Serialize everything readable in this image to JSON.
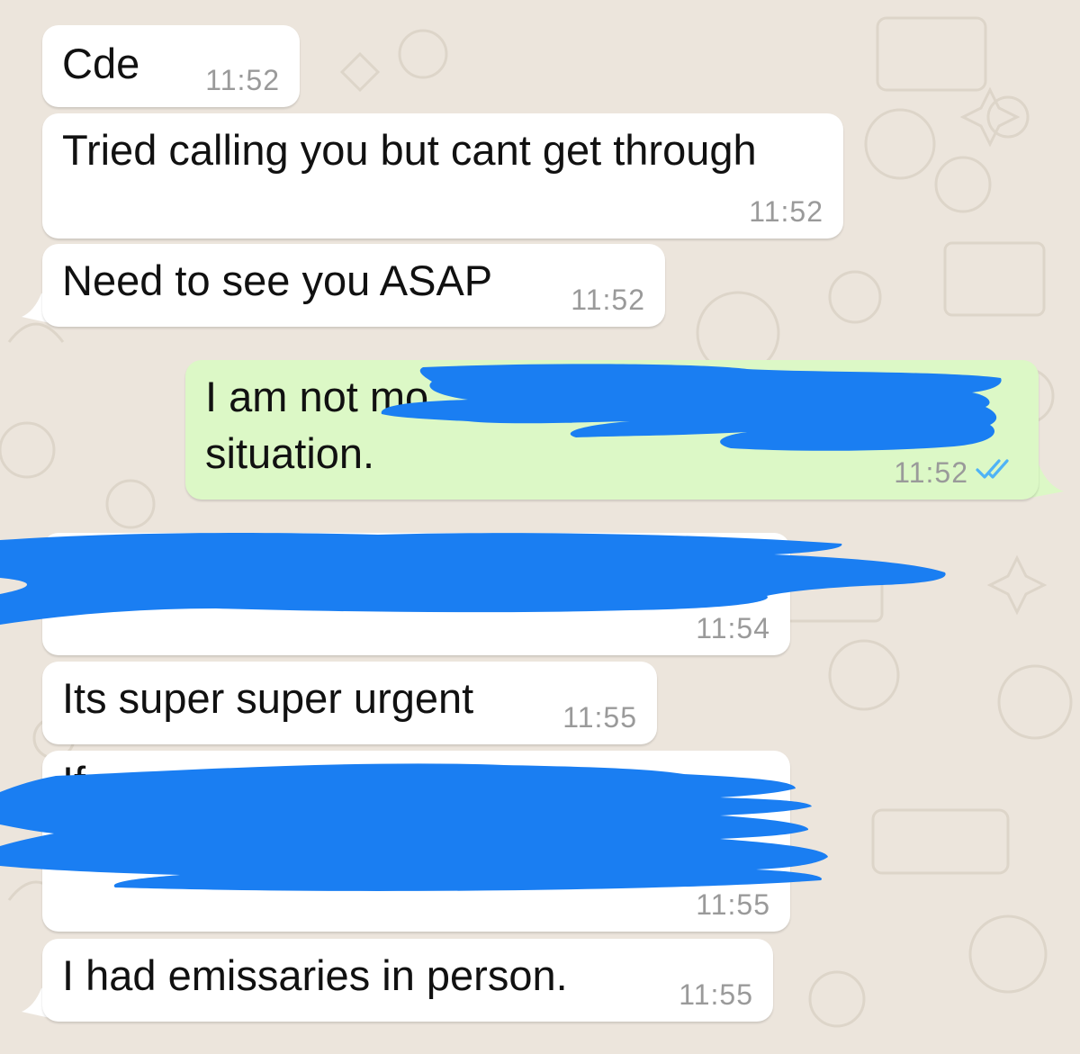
{
  "chat": {
    "messages": [
      {
        "direction": "incoming",
        "text": "Cde",
        "time": "11:52"
      },
      {
        "direction": "incoming",
        "text": "Tried calling you but cant get through",
        "time": "11:52"
      },
      {
        "direction": "incoming",
        "text": "Need to see you ASAP",
        "time": "11:52"
      },
      {
        "direction": "outgoing",
        "text": [
          "I am not mo",
          "situation."
        ],
        "time": "11:52",
        "status": "read",
        "status_icon": "double-check-icon"
      },
      {
        "direction": "incoming",
        "text": "",
        "time": "11:54",
        "redacted": true
      },
      {
        "direction": "incoming",
        "text": "Its super super urgent",
        "time": "11:55"
      },
      {
        "direction": "incoming",
        "text": "If",
        "time": "11:55",
        "redacted": true
      },
      {
        "direction": "incoming",
        "text": "I had emissaries in person.",
        "time": "11:55"
      }
    ]
  },
  "colors": {
    "background": "#ece5dc",
    "incoming_bubble": "#ffffff",
    "outgoing_bubble": "#dcf8c6",
    "read_ticks": "#4fb3f6",
    "redaction": "#1a7ef2",
    "timestamp": "#9a9a9a"
  }
}
